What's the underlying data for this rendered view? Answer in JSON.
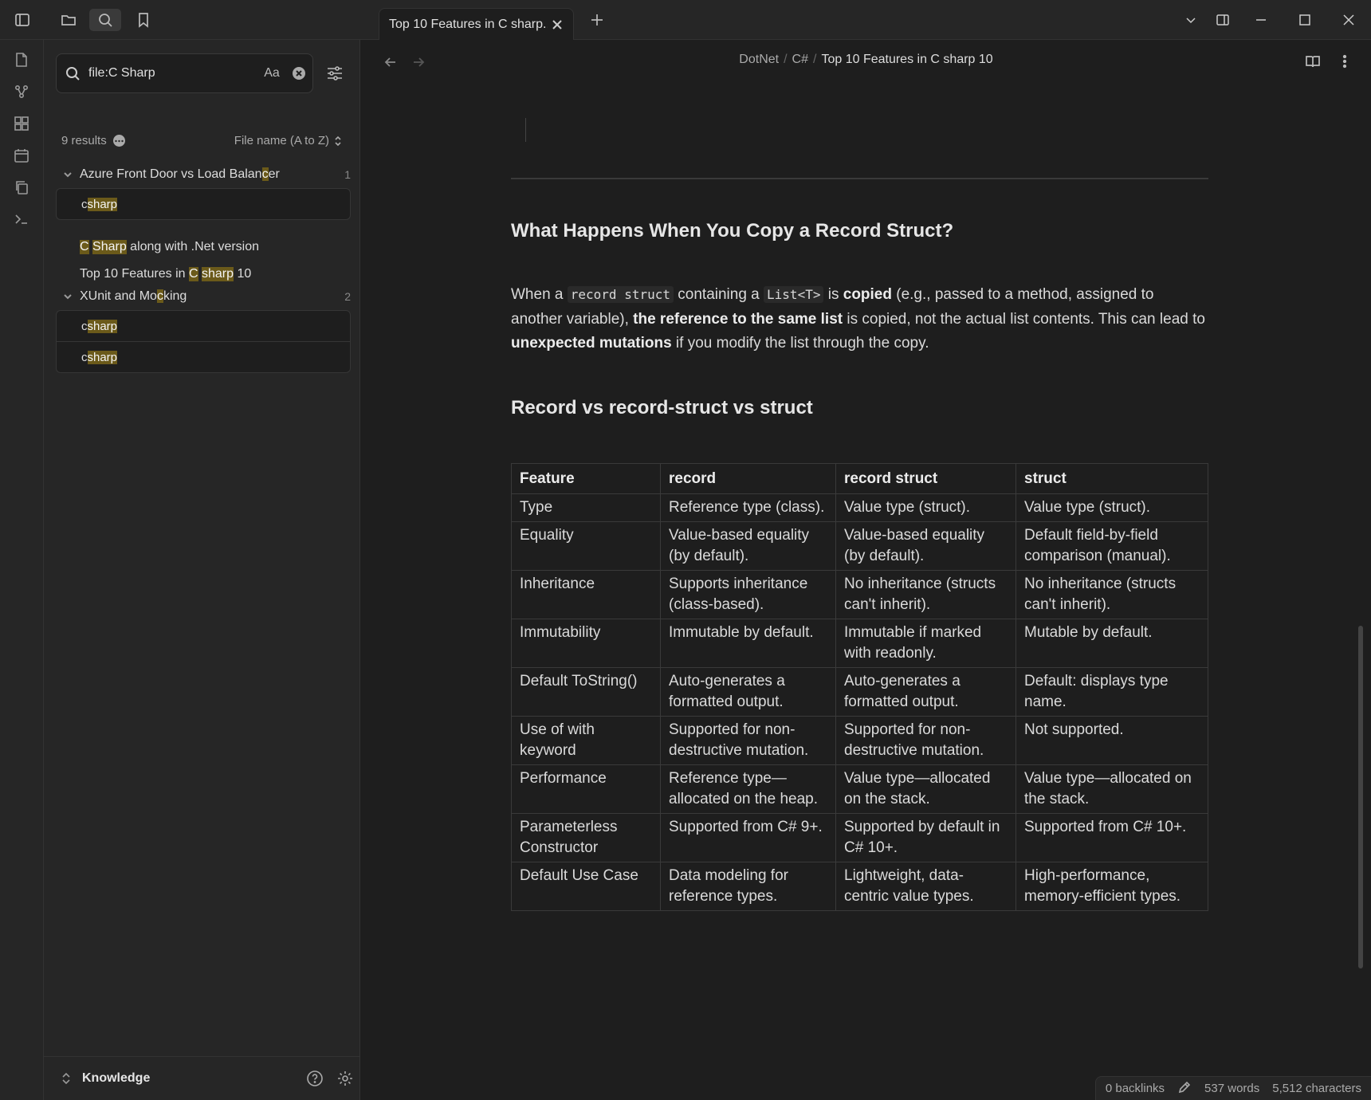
{
  "tab": {
    "title": "Top 10 Features in C sharp..."
  },
  "search": {
    "query": "file:C Sharp",
    "case_label": "Aa",
    "results_count": "9 results",
    "sort_label": "File name (A to Z)"
  },
  "results": {
    "file1": {
      "name_pre": "Azure Front Door vs Load Balan",
      "name_hl": "c",
      "name_post": "er",
      "count": "1",
      "match1_pre": "c",
      "match1_hl": "sharp"
    },
    "file2": {
      "hl1": "C",
      "sp": " ",
      "hl2": "Sharp",
      "post": " along with .Net version"
    },
    "file3": {
      "pre": "Top 10 Features in ",
      "hl1": "C",
      "sp": " ",
      "hl2": "sharp",
      "post": " 10"
    },
    "file4": {
      "name_pre": "XUnit and Mo",
      "name_hl": "c",
      "name_post": "king",
      "count": "2",
      "match_pre": "c",
      "match_hl": "sharp"
    }
  },
  "vault": {
    "name": "Knowledge"
  },
  "breadcrumb": {
    "part1": "DotNet",
    "part2": "C#",
    "current": "Top 10 Features in C sharp 10"
  },
  "doc": {
    "h_copy": "What Happens When You Copy a Record Struct?",
    "p": {
      "t1": "When a ",
      "c1": "record struct",
      "t2": " containing a ",
      "c2": "List<T>",
      "t3": " is ",
      "b1": "copied",
      "t4": " (e.g., passed to a method, assigned to another variable), ",
      "b2": "the reference to the same list",
      "t5": " is copied, not the actual list contents. This can lead to ",
      "b3": "unexpected mutations",
      "t6": " if you modify the list through the copy."
    },
    "h_table": "Record vs record-struct vs struct",
    "table": {
      "headers": [
        "Feature",
        "record",
        "record struct",
        "struct"
      ],
      "rows": [
        [
          "Type",
          "Reference type (class).",
          "Value type (struct).",
          "Value type (struct)."
        ],
        [
          "Equality",
          "Value-based equality (by default).",
          "Value-based equality (by default).",
          "Default field-by-field comparison (manual)."
        ],
        [
          "Inheritance",
          "Supports inheritance (class-based).",
          "No inheritance (structs can't inherit).",
          "No inheritance (structs can't inherit)."
        ],
        [
          "Immutability",
          "Immutable by default.",
          "Immutable if marked with readonly.",
          "Mutable by default."
        ],
        [
          "Default ToString()",
          "Auto-generates a formatted output.",
          "Auto-generates a formatted output.",
          "Default: displays type name."
        ],
        [
          "Use of with keyword",
          "Supported for non-destructive mutation.",
          "Supported for non-destructive mutation.",
          "Not supported."
        ],
        [
          "Performance",
          "Reference type—allocated on the heap.",
          "Value type—allocated on the stack.",
          "Value type—allocated on the stack."
        ],
        [
          "Parameterless Constructor",
          "Supported from C# 9+.",
          "Supported by default in C# 10+.",
          "Supported from C# 10+."
        ],
        [
          "Default Use Case",
          "Data modeling for reference types.",
          "Lightweight, data-centric value types.",
          "High-performance, memory-efficient types."
        ]
      ]
    }
  },
  "status": {
    "backlinks": "0 backlinks",
    "words": "537 words",
    "chars": "5,512 characters"
  }
}
